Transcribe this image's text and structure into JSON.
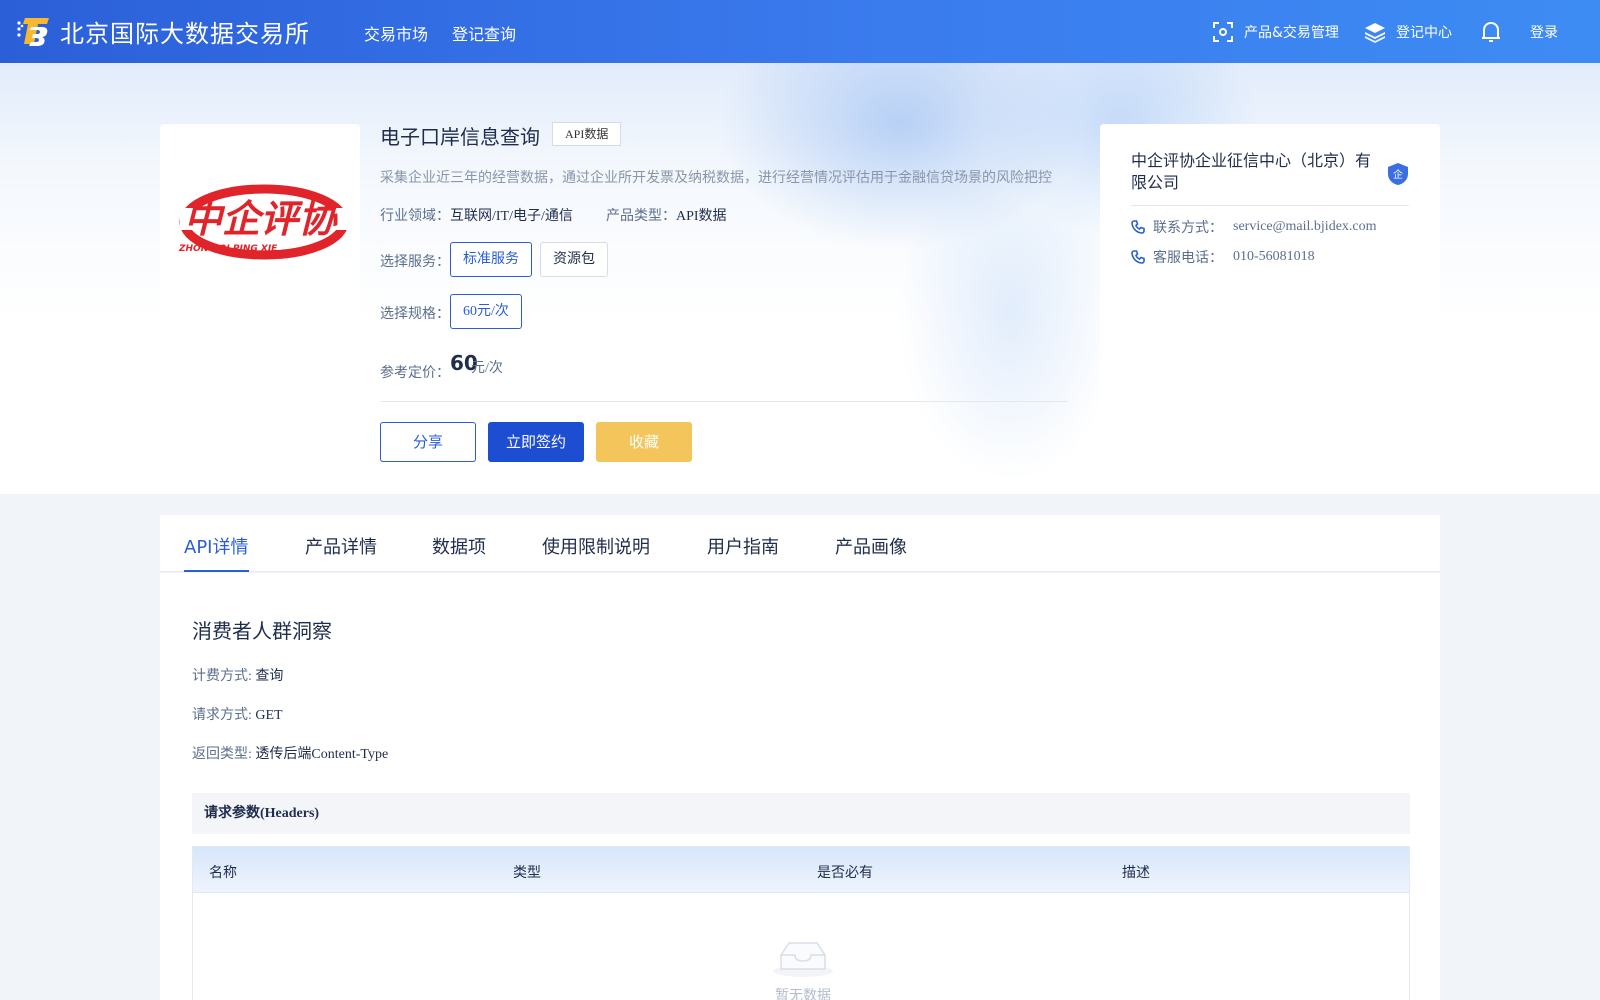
{
  "header": {
    "site_name": "北京国际大数据交易所",
    "nav": [
      "交易市场",
      "登记查询"
    ],
    "product_mgmt": "产品&交易管理",
    "register_center": "登记中心",
    "login": "登录"
  },
  "product": {
    "title": "电子口岸信息查询",
    "tag": "API数据",
    "description": "采集企业近三年的经营数据，通过企业所开发票及纳税数据，进行经营情况评估用于金融信贷场景的风险把控",
    "industry_label": "行业领域：",
    "industry_value": "互联网/IT/电子/通信",
    "type_label": "产品类型：",
    "type_value": "API数据",
    "service_label": "选择服务：",
    "services": [
      "标准服务",
      "资源包"
    ],
    "selected_service": "标准服务",
    "spec_label": "选择规格：",
    "specs": [
      "60元/次"
    ],
    "price_label": "参考定价：",
    "price_value": "60",
    "price_unit": "元/次",
    "logo_text": "中企评协",
    "logo_subtext": "ZHONG QI PING XIE",
    "logo_color": "#e0242a"
  },
  "actions": {
    "share": "分享",
    "sign": "立即签约",
    "favorite": "收藏"
  },
  "company": {
    "name": "中企评协企业征信中心（北京）有限公司",
    "badge": "企",
    "contact_label": "联系方式：",
    "contact_value": "service@mail.bjidex.com",
    "phone_label": "客服电话：",
    "phone_value": "010-56081018"
  },
  "tabs": {
    "items": [
      "API详情",
      "产品详情",
      "数据项",
      "使用限制说明",
      "用户指南",
      "产品画像"
    ],
    "active": "API详情"
  },
  "api_detail": {
    "title": "消费者人群洞察",
    "billing_label": "计费方式:",
    "billing_value": "查询",
    "method_label": "请求方式:",
    "method_value": "GET",
    "return_label": "返回类型:",
    "return_value": "透传后端Content-Type",
    "params_title": "请求参数(Headers)",
    "columns": [
      "名称",
      "类型",
      "是否必有",
      "描述"
    ],
    "empty_text": "暂无数据"
  },
  "colors": {
    "primary": "#2a5dd7",
    "header_gradient_start": "#2b5fd8",
    "header_gradient_end": "#3d8cf3",
    "favorite": "#f4c55a",
    "logo_red": "#e0242a"
  },
  "icons": [
    "logo-icon",
    "scan-icon",
    "layers-icon",
    "bell-icon",
    "shield-badge-icon",
    "phone-icon",
    "empty-box-icon"
  ]
}
